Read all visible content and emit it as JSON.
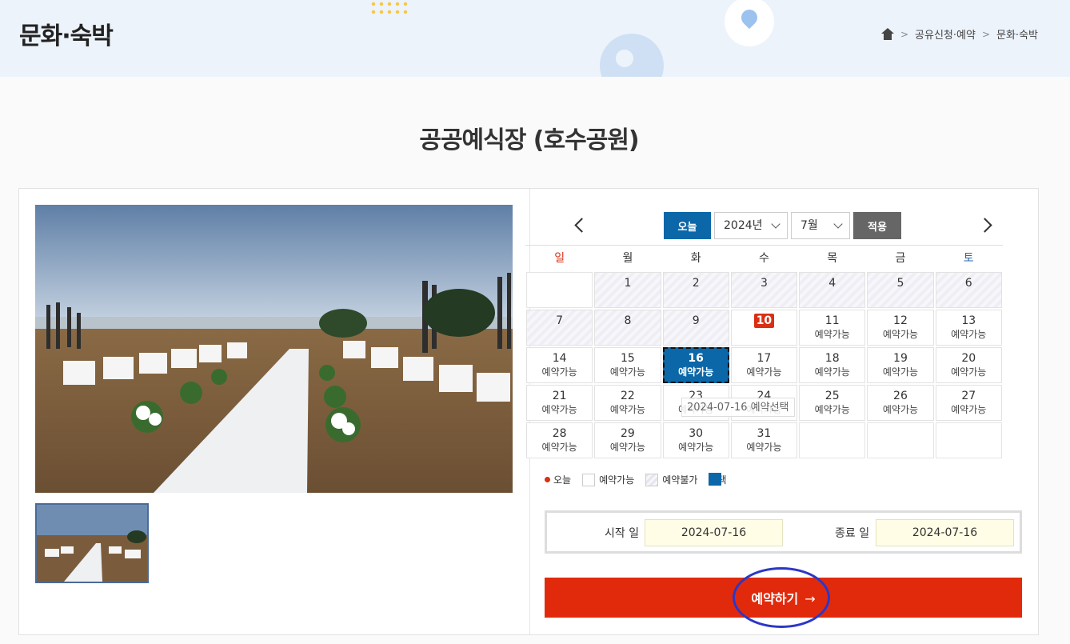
{
  "header": {
    "title": "문화·숙박",
    "breadcrumb": [
      "공유신청·예약",
      "문화·숙박"
    ]
  },
  "page_title": "공공예식장 (호수공원)",
  "calendar": {
    "today_label": "오늘",
    "year_value": "2024년",
    "month_value": "7월",
    "apply_label": "적용",
    "weekdays": [
      "일",
      "월",
      "화",
      "수",
      "목",
      "금",
      "토"
    ],
    "weeks": [
      [
        {
          "n": "",
          "s": "",
          "t": "empty"
        },
        {
          "n": "1",
          "s": "",
          "t": "unavail"
        },
        {
          "n": "2",
          "s": "",
          "t": "unavail"
        },
        {
          "n": "3",
          "s": "",
          "t": "unavail"
        },
        {
          "n": "4",
          "s": "",
          "t": "unavail"
        },
        {
          "n": "5",
          "s": "",
          "t": "unavail"
        },
        {
          "n": "6",
          "s": "",
          "t": "unavail"
        }
      ],
      [
        {
          "n": "7",
          "s": "",
          "t": "unavail"
        },
        {
          "n": "8",
          "s": "",
          "t": "unavail"
        },
        {
          "n": "9",
          "s": "",
          "t": "unavail"
        },
        {
          "n": "10",
          "s": "",
          "t": "today"
        },
        {
          "n": "11",
          "s": "예약가능",
          "t": "avail"
        },
        {
          "n": "12",
          "s": "예약가능",
          "t": "avail"
        },
        {
          "n": "13",
          "s": "예약가능",
          "t": "avail"
        }
      ],
      [
        {
          "n": "14",
          "s": "예약가능",
          "t": "avail"
        },
        {
          "n": "15",
          "s": "예약가능",
          "t": "avail"
        },
        {
          "n": "16",
          "s": "예약가능",
          "t": "selected"
        },
        {
          "n": "17",
          "s": "예약가능",
          "t": "avail"
        },
        {
          "n": "18",
          "s": "예약가능",
          "t": "avail"
        },
        {
          "n": "19",
          "s": "예약가능",
          "t": "avail"
        },
        {
          "n": "20",
          "s": "예약가능",
          "t": "avail"
        }
      ],
      [
        {
          "n": "21",
          "s": "예약가능",
          "t": "avail"
        },
        {
          "n": "22",
          "s": "예약가능",
          "t": "avail"
        },
        {
          "n": "23",
          "s": "예약가능",
          "t": "avail"
        },
        {
          "n": "24",
          "s": "예약가능",
          "t": "avail"
        },
        {
          "n": "25",
          "s": "예약가능",
          "t": "avail"
        },
        {
          "n": "26",
          "s": "예약가능",
          "t": "avail"
        },
        {
          "n": "27",
          "s": "예약가능",
          "t": "avail"
        }
      ],
      [
        {
          "n": "28",
          "s": "예약가능",
          "t": "avail"
        },
        {
          "n": "29",
          "s": "예약가능",
          "t": "avail"
        },
        {
          "n": "30",
          "s": "예약가능",
          "t": "avail"
        },
        {
          "n": "31",
          "s": "예약가능",
          "t": "avail"
        },
        {
          "n": "",
          "s": "",
          "t": "empty"
        },
        {
          "n": "",
          "s": "",
          "t": "empty"
        },
        {
          "n": "",
          "s": "",
          "t": "empty"
        }
      ]
    ],
    "tooltip": "2024-07-16 예약선택"
  },
  "legend": {
    "today": "오늘",
    "available": "예약가능",
    "unavailable": "예약불가",
    "selected": "선택"
  },
  "dates": {
    "start_label": "시작 일",
    "start_value": "2024-07-16",
    "end_label": "종료 일",
    "end_value": "2024-07-16"
  },
  "reserve_button": {
    "label": "예약하기",
    "arrow": "→"
  },
  "colors": {
    "accent_blue": "#0b67a8",
    "reserve_red": "#e12a0c",
    "today_red": "#d93015",
    "annotation_circle": "#2b37c8"
  }
}
